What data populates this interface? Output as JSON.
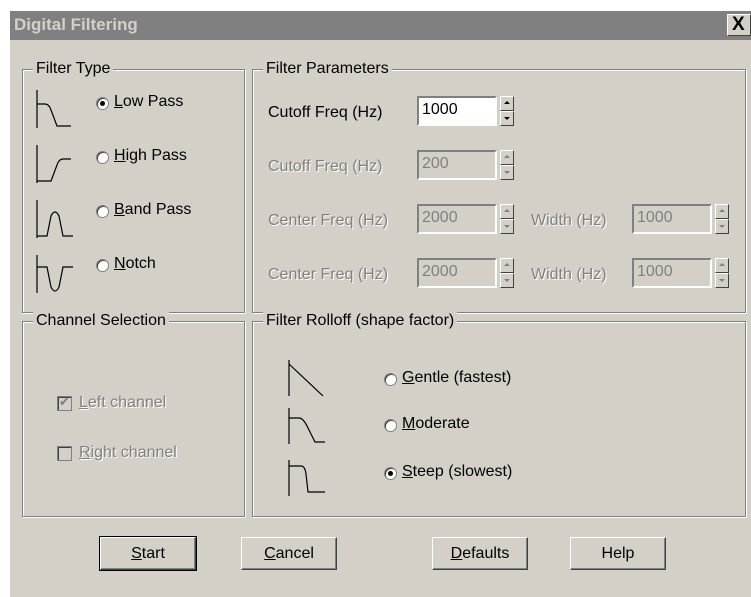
{
  "window": {
    "title": "Digital Filtering",
    "close_label": "X"
  },
  "filter_type": {
    "legend": "Filter Type",
    "options": [
      {
        "key": "L",
        "rest": "ow Pass",
        "checked": true
      },
      {
        "key": "H",
        "rest": "igh Pass",
        "checked": false
      },
      {
        "key": "B",
        "rest": "and Pass",
        "checked": false
      },
      {
        "key": "N",
        "rest": "otch",
        "checked": false
      }
    ]
  },
  "filter_params": {
    "legend": "Filter Parameters",
    "rows": [
      {
        "label": "Cutoff Freq (Hz)",
        "value": "1000",
        "enabled": true
      },
      {
        "label": "Cutoff Freq (Hz)",
        "value": "200",
        "enabled": false
      },
      {
        "label": "Center Freq (Hz)",
        "value": "2000",
        "enabled": false,
        "width_label": "Width (Hz)",
        "width_value": "1000"
      },
      {
        "label": "Center Freq (Hz)",
        "value": "2000",
        "enabled": false,
        "width_label": "Width (Hz)",
        "width_value": "1000"
      }
    ]
  },
  "channel_selection": {
    "legend": "Channel Selection",
    "left": {
      "key": "L",
      "rest": "eft channel",
      "checked": true,
      "enabled": false
    },
    "right": {
      "key": "R",
      "rest": "ight channel",
      "checked": false,
      "enabled": false
    }
  },
  "rolloff": {
    "legend": "Filter Rolloff (shape factor)",
    "options": [
      {
        "key": "G",
        "rest": "entle (fastest)",
        "checked": false
      },
      {
        "key": "M",
        "rest": "oderate",
        "checked": false
      },
      {
        "key": "S",
        "rest": "teep (slowest)",
        "checked": true
      }
    ]
  },
  "buttons": {
    "start": {
      "key": "S",
      "rest": "tart"
    },
    "cancel": {
      "key": "C",
      "rest": "ancel"
    },
    "defaults": {
      "key": "D",
      "rest": "efaults"
    },
    "help": {
      "label": "Help"
    }
  },
  "colors": {
    "face": "#d4d0c8",
    "titlebar": "#808080",
    "disabled_text": "#808080"
  }
}
